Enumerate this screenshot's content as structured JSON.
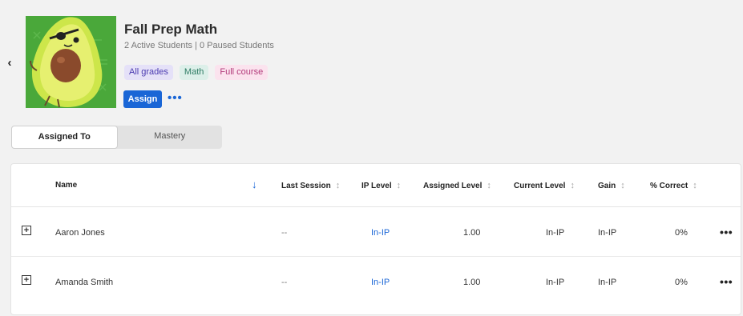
{
  "header": {
    "title": "Fall Prep Math",
    "subtitle": "2 Active Students | 0 Paused Students",
    "tags": [
      "All grades",
      "Math",
      "Full course"
    ],
    "assign_label": "Assign"
  },
  "tabs": [
    {
      "label": "Assigned To",
      "active": true
    },
    {
      "label": "Mastery",
      "active": false
    }
  ],
  "table": {
    "columns": [
      "Name",
      "Last Session",
      "IP Level",
      "Assigned Level",
      "Current Level",
      "Gain",
      "% Correct"
    ],
    "rows": [
      {
        "name": "Aaron Jones",
        "last_session": "--",
        "ip_level": "In-IP",
        "assigned_level": "1.00",
        "current_level": "In-IP",
        "gain": "In-IP",
        "correct": "0%"
      },
      {
        "name": "Amanda Smith",
        "last_session": "--",
        "ip_level": "In-IP",
        "assigned_level": "1.00",
        "current_level": "In-IP",
        "gain": "In-IP",
        "correct": "0%"
      }
    ]
  },
  "colors": {
    "accent": "#1a66d6",
    "thumb_bg": "#4aa83a"
  }
}
